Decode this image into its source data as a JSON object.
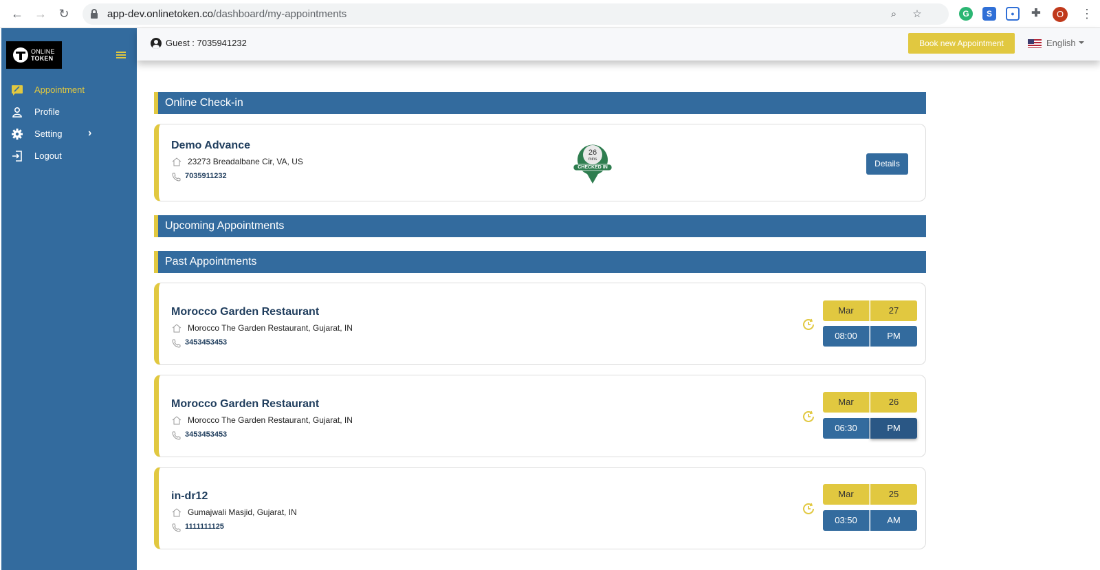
{
  "browser": {
    "url_host": "app-dev.onlinetoken.co",
    "url_path": "/dashboard/my-appointments",
    "profile_initial": "O"
  },
  "sidebar": {
    "logo_line1": "ONLINE",
    "logo_line2": "TOKEN",
    "items": [
      {
        "label": "Appointment",
        "icon": "appointment-icon",
        "active": true
      },
      {
        "label": "Profile",
        "icon": "person-icon",
        "active": false
      },
      {
        "label": "Setting",
        "icon": "gear-icon",
        "active": false
      },
      {
        "label": "Logout",
        "icon": "logout-icon",
        "active": false
      }
    ]
  },
  "header": {
    "guest_label": "Guest : 7035941232",
    "book_button": "Book new Appointment",
    "language": "English"
  },
  "sections": {
    "checkin_title": "Online Check-in",
    "upcoming_title": "Upcoming Appointments",
    "past_title": "Past Appointments"
  },
  "checkin": {
    "name": "Demo Advance",
    "address": "23273 Breadalbane Cir, VA, US",
    "phone": "7035911232",
    "wait_value": "26",
    "wait_unit": "mins",
    "status": "CHECKED IN",
    "details_button": "Details"
  },
  "past": [
    {
      "name": "Morocco Garden Restaurant",
      "address": "Morocco The Garden Restaurant, Gujarat, IN",
      "phone": "3453453453",
      "month": "Mar",
      "day": "27",
      "time": "08:00",
      "ampm": "PM"
    },
    {
      "name": "Morocco Garden Restaurant",
      "address": "Morocco The Garden Restaurant, Gujarat, IN",
      "phone": "3453453453",
      "month": "Mar",
      "day": "26",
      "time": "06:30",
      "ampm": "PM"
    },
    {
      "name": "in-dr12",
      "address": "Gumajwali Masjid, Gujarat, IN",
      "phone": "1111111125",
      "month": "Mar",
      "day": "25",
      "time": "03:50",
      "ampm": "AM"
    }
  ],
  "colors": {
    "primary_blue": "#336b9e",
    "accent_yellow": "#e1c840"
  }
}
